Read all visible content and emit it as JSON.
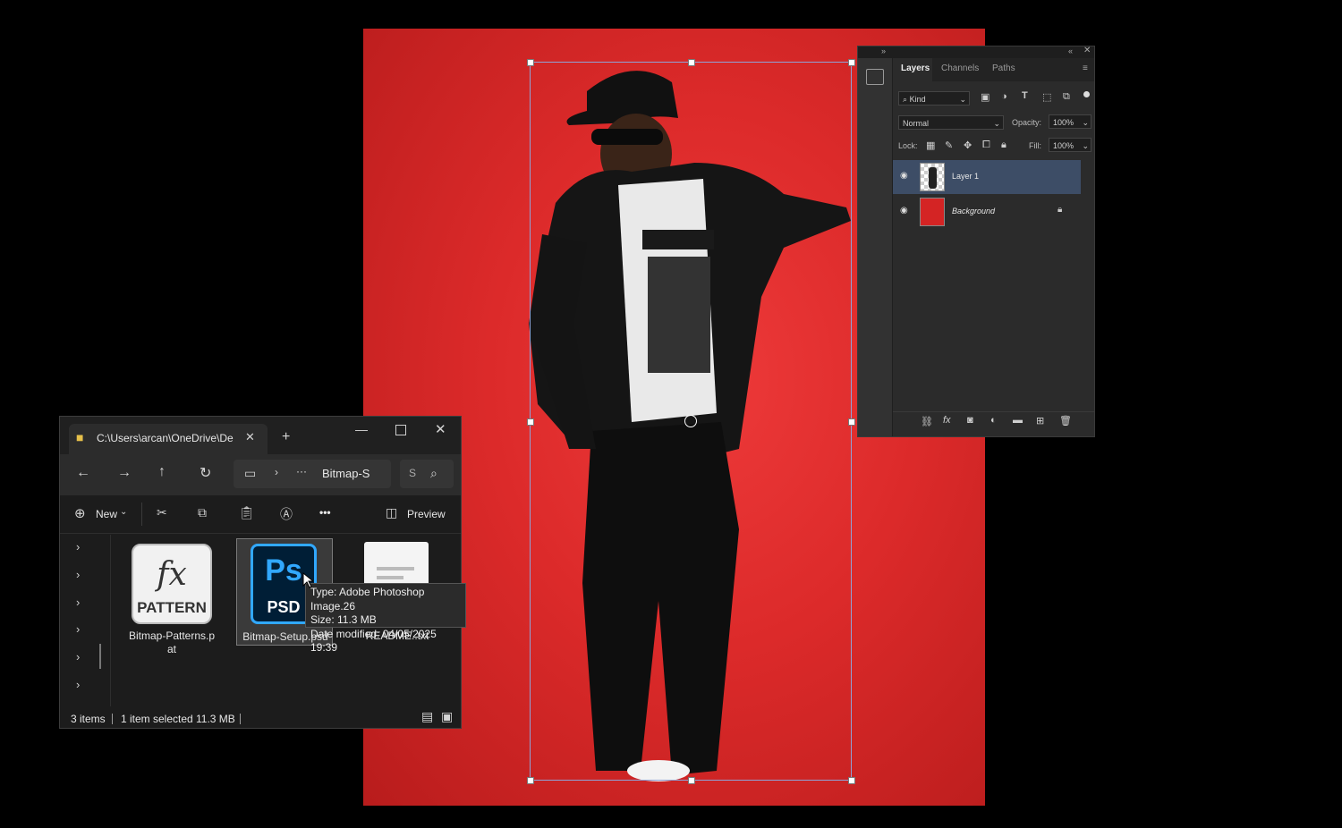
{
  "photoshop": {
    "tabs": [
      "Layers",
      "Channels",
      "Paths"
    ],
    "filter": {
      "label": "Kind"
    },
    "blend_mode": "Normal",
    "opacity": {
      "label": "Opacity:",
      "value": "100%"
    },
    "lock": {
      "label": "Lock:"
    },
    "fill": {
      "label": "Fill:",
      "value": "100%"
    },
    "layers": [
      {
        "name": "Layer 1",
        "visible": true,
        "selected": true
      },
      {
        "name": "Background",
        "visible": true,
        "locked": true
      }
    ],
    "colors": {
      "selected_row": "#3d4d66",
      "panel_bg": "#2b2b2b"
    }
  },
  "explorer": {
    "tab_title": "C:\\Users\\arcan\\OneDrive\\Des",
    "breadcrumb_current": "Bitmap-S",
    "breadcrumb_ellipsis": "···",
    "search_placeholder": "S",
    "toolbar": {
      "new_label": "New",
      "more_label": "•••",
      "preview_label": "Preview"
    },
    "files": [
      {
        "name": "Bitmap-Patterns.pat",
        "name_line1": "Bitmap-Patterns.p",
        "name_line2": "at",
        "icon_text_top": "fx",
        "icon_text_bottom": "PATTERN"
      },
      {
        "name": "Bitmap-Setup.psd",
        "icon_text_top": "Ps",
        "icon_text_bottom": "PSD",
        "selected": true
      },
      {
        "name": "README..txt"
      }
    ],
    "tooltip": {
      "type": "Type: Adobe Photoshop Image.26",
      "size": "Size: 11.3 MB",
      "modified": "Date modified: 04/05/2025 19:39"
    },
    "status": {
      "items": "3 items",
      "selected": "1 item selected",
      "size": "11.3 MB"
    }
  },
  "canvas": {
    "background_color": "#e03030"
  }
}
